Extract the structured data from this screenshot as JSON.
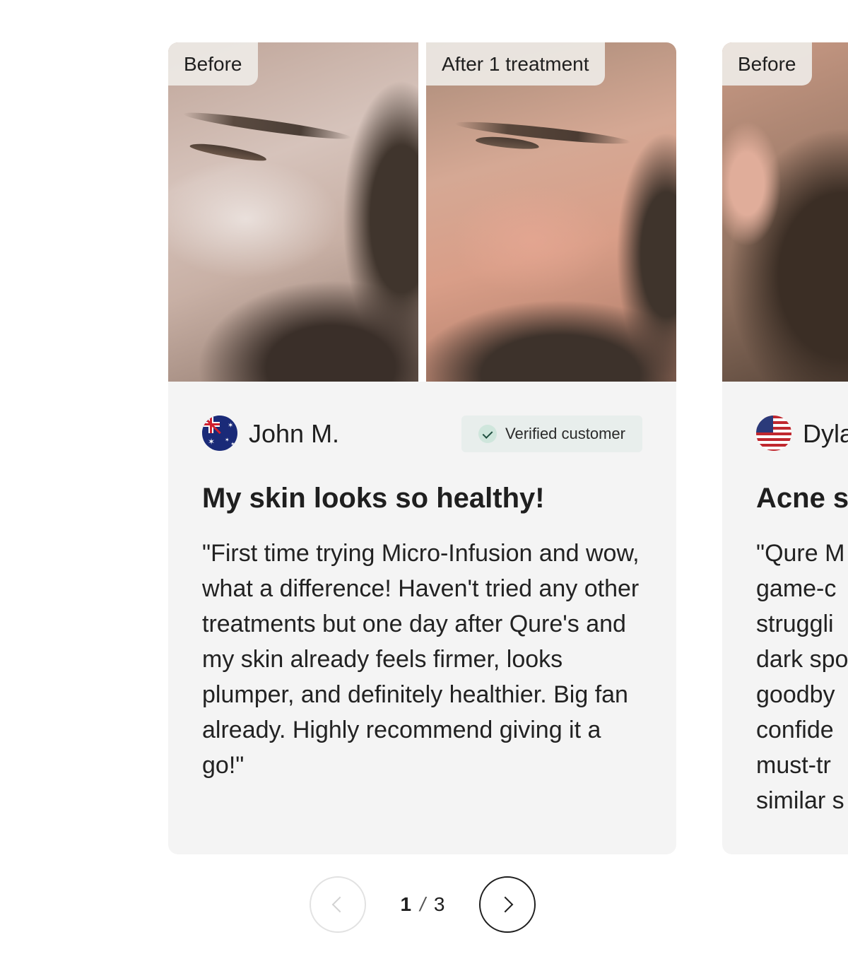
{
  "pagination": {
    "current": "1",
    "separator": "/",
    "total": "3",
    "prev_icon": "chevron-left-icon",
    "next_icon": "chevron-right-icon"
  },
  "reviews": [
    {
      "before_label": "Before",
      "after_label": "After 1 treatment",
      "flag": "australia-flag-icon",
      "name": "John M.",
      "verified_label": "Verified customer",
      "title": "My skin looks so healthy!",
      "body": "\"First time trying Micro-Infusion and wow, what a difference! Haven't tried any other treatments but one day after Qure's and my skin already feels firmer, looks plumper, and definitely healthier. Big fan already. Highly recommend giving it a go!\""
    },
    {
      "before_label": "Before",
      "flag": "usa-flag-icon",
      "name": "Dyla",
      "title": "Acne s",
      "body_lines": [
        "\"Qure M",
        "game-c",
        "struggli",
        "dark spo",
        "goodby",
        "confide",
        "must-tr",
        "similar s"
      ]
    }
  ],
  "colors": {
    "card_background": "#f4f4f4",
    "verified_background": "#e8eeec",
    "check_accent": "#cfe6dc",
    "text": "#1f1f1f"
  }
}
